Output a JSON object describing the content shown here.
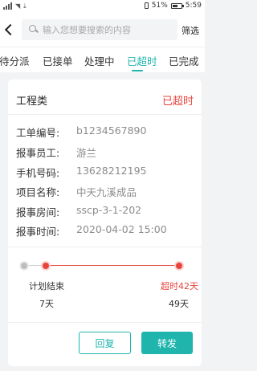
{
  "status_bar": {
    "battery_percent": "51%",
    "time": "5:59"
  },
  "search": {
    "placeholder": "输入您想要搜索的内容",
    "filter_label": "筛选"
  },
  "tabs": [
    {
      "label": "待分派",
      "active": false
    },
    {
      "label": "已接单",
      "active": false
    },
    {
      "label": "处理中",
      "active": false
    },
    {
      "label": "已超时",
      "active": true
    },
    {
      "label": "已完成",
      "active": false
    }
  ],
  "card": {
    "title": "工程类",
    "status": "已超时",
    "fields": [
      {
        "label": "工单编号:",
        "value": "b1234567890"
      },
      {
        "label": "报事员工:",
        "value": "游兰"
      },
      {
        "label": "手机号码:",
        "value": "13628212195"
      },
      {
        "label": "项目名称:",
        "value": "中天九溪成品"
      },
      {
        "label": "报事房间:",
        "value": "sscp-3-1-202"
      },
      {
        "label": "报事时间:",
        "value": "2020-04-02 15:00"
      }
    ],
    "timeline": {
      "plan_label": "计划结束",
      "plan_value": "7天",
      "overdue_label": "超时42天",
      "overdue_value": "49天"
    },
    "actions": {
      "reply_label": "回复",
      "forward_label": "转发"
    }
  },
  "colors": {
    "accent": "#1fb5ad",
    "overdue": "#e8443e"
  }
}
